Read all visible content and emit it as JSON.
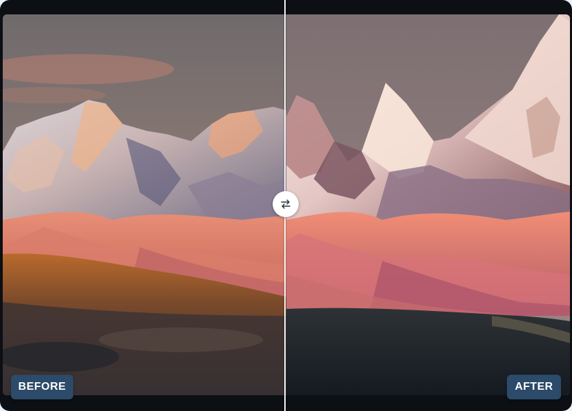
{
  "comparison": {
    "before_label": "BEFORE",
    "after_label": "AFTER",
    "divider_position": 0.5,
    "handle_icon": "swap-arrows-icon"
  },
  "colors": {
    "badge_background": "#2c4a69",
    "badge_text": "#ffffff",
    "divider": "#f4f6f8",
    "frame": "#0c0f14"
  }
}
